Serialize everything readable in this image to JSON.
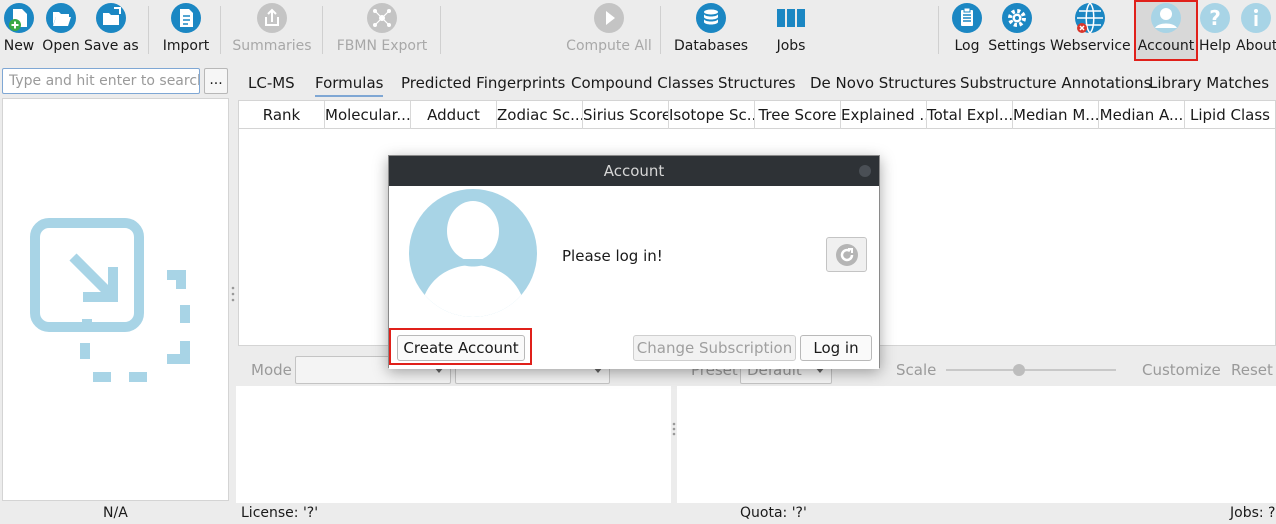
{
  "toolbar": {
    "new": "New",
    "open": "Open",
    "save_as": "Save as",
    "import": "Import",
    "summaries": "Summaries",
    "fbmn_export": "FBMN Export",
    "compute_all": "Compute All",
    "databases": "Databases",
    "jobs": "Jobs",
    "log": "Log",
    "settings": "Settings",
    "webservice": "Webservice",
    "account": "Account",
    "help": "Help",
    "about": "About"
  },
  "search": {
    "placeholder": "Type and hit enter to search",
    "more_label": "..."
  },
  "tabs": [
    "LC-MS",
    "Formulas",
    "Predicted Fingerprints",
    "Compound Classes",
    "Structures",
    "De Novo Structures",
    "Substructure Annotations",
    "Library Matches"
  ],
  "table": {
    "columns": [
      "Rank",
      "Molecular...",
      "Adduct",
      "Zodiac Sc...",
      "Sirius Score",
      "Isotope Sc...",
      "Tree Score",
      "Explained ...",
      "Total Expl...",
      "Median M...",
      "Median A...",
      "Lipid Class"
    ]
  },
  "bottom": {
    "mode_label": "Mode",
    "preset_label": "Preset",
    "preset_value": "Default",
    "scale_label": "Scale",
    "customize_label": "Customize",
    "reset_label": "Reset"
  },
  "status": {
    "left": "N/A",
    "license": "License: '?'",
    "quota": "Quota: '?'",
    "jobs": "Jobs: ?"
  },
  "dialog": {
    "title": "Account",
    "message": "Please log in!",
    "create_account": "Create Account",
    "change_subscription": "Change Subscription",
    "log_in": "Log in"
  },
  "colors": {
    "icon_blue": "#1b87c3",
    "highlight_red": "#e0201a",
    "avatar_blue": "#a8d4e6",
    "title_bar": "#2e3236"
  }
}
